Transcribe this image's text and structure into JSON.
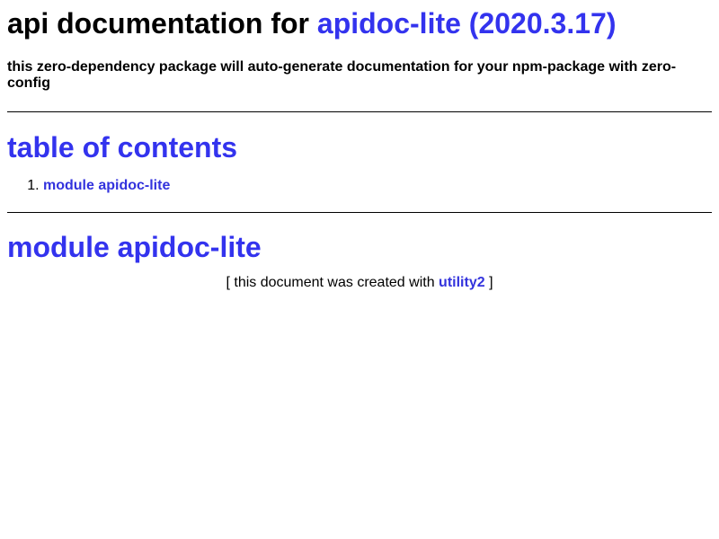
{
  "header": {
    "title_prefix": "api documentation for",
    "title_link": "apidoc-lite (2020.3.17)"
  },
  "description": "this zero-dependency package will auto-generate documentation for your npm-package with zero-config",
  "toc": {
    "heading": "table of contents",
    "items": [
      {
        "label": "module apidoc-lite"
      }
    ]
  },
  "module": {
    "heading": "module apidoc-lite"
  },
  "footer": {
    "text_before": "[ this document was created with",
    "link": "utility2",
    "text_after": "]"
  },
  "colors": {
    "link": "#3333ee",
    "text": "#000000",
    "background": "#ffffff"
  }
}
